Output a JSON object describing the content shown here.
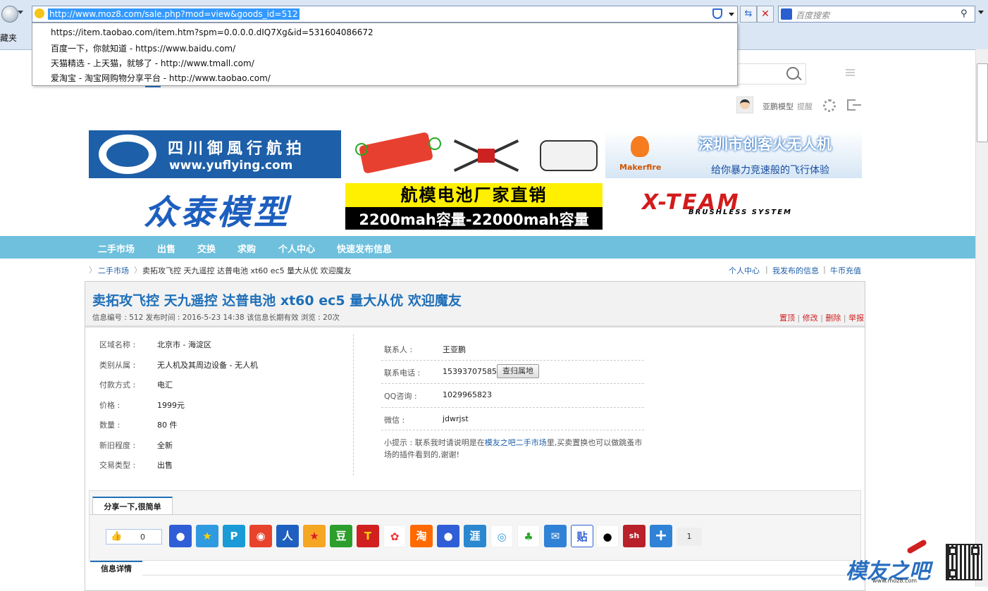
{
  "browser": {
    "url": "http://www.moz8.com/sale.php?mod=view&goods_id=512",
    "search_placeholder": "百度搜索",
    "favorites_label": "收藏夹",
    "suggestions": [
      "https://item.taobao.com/item.htm?spm=0.0.0.0.dIQ7Xg&id=531604086672",
      "百度一下，你就知道 - https://www.baidu.com/",
      "天猫精选 - 上天猫，就够了 - http://www.tmall.com/",
      "爱淘宝 - 淘宝网购物分享平台 - http://www.taobao.com/"
    ]
  },
  "header": {
    "username": "亚鹏模型",
    "remind_label": "提醒"
  },
  "banners": {
    "yuflying_title": "四川御風行航拍",
    "yuflying_url": "www.yuflying.com",
    "makerfire_title": "深圳市创客火无人机",
    "makerfire_sub": "给你暴力竞速般的飞行体验",
    "makerfire_brand": "Makerfire",
    "zhongtai": "众泰模型",
    "battery_title": "航模电池厂家直销",
    "battery_sub": "2200mah容量-22000mah容量",
    "xteam": "X-TEAM",
    "xteam_sub": "BRUSHLESS SYSTEM"
  },
  "nav": [
    "二手市场",
    "出售",
    "交换",
    "求购",
    "个人中心",
    "快速发布信息"
  ],
  "breadcrumb": {
    "root": "二手市场",
    "current": "卖拓攻飞控 天九遥控 达普电池 xt60 ec5 量大从优 欢迎魔友",
    "links": [
      "个人中心",
      "我发布的信息",
      "牛币充值"
    ]
  },
  "listing": {
    "title": "卖拓攻飞控 天九遥控 达普电池 xt60 ec5 量大从优 欢迎魔友",
    "meta": "信息编号 : 512 发布时间 : 2016-5-23 14:38 该信息长期有效 浏览 : 20次",
    "actions": [
      "置顶",
      "修改",
      "删除",
      "举报"
    ],
    "fields": [
      {
        "label": "区域名称 :",
        "value": "北京市 - 海淀区"
      },
      {
        "label": "类别从属 :",
        "value": "无人机及其周边设备 - 无人机"
      },
      {
        "label": "付款方式 :",
        "value": "电汇"
      },
      {
        "label": "价格 :",
        "value": "1999元"
      },
      {
        "label": "数量 :",
        "value": "80 件"
      },
      {
        "label": "新旧程度 :",
        "value": "全新"
      },
      {
        "label": "交易类型 :",
        "value": "出售"
      }
    ],
    "contact": [
      {
        "label": "联系人 :",
        "value": "王亚鹏"
      },
      {
        "label": "联系电话 :",
        "value": "15393707585"
      },
      {
        "label": "QQ咨询 :",
        "value": "1029965823"
      },
      {
        "label": "微信 :",
        "value": "jdwrjst"
      }
    ],
    "phone_button": "查归属地",
    "tip_prefix": "小提示 : 联系我时请说明是在",
    "tip_link": "模友之吧二手市场",
    "tip_suffix": "里,买卖置换也可以做跳蚤市",
    "tip_line2": "场的插件看到的,谢谢!"
  },
  "share": {
    "tab_label": "分享一下,很简单",
    "like_count": "0",
    "total_count": "1",
    "icons": [
      "baidu-paw",
      "star",
      "pinyou",
      "weibo",
      "renren",
      "kaixin",
      "douban",
      "tianya",
      "diandian",
      "taotao",
      "baidu-hi",
      "huaban",
      "360",
      "clover",
      "mail",
      "tieba",
      "qq",
      "sohu",
      "more"
    ],
    "detail_tab": "信息详情"
  },
  "watermark": {
    "logo_text": "模友之吧",
    "logo_url": "www.moz8.com"
  }
}
